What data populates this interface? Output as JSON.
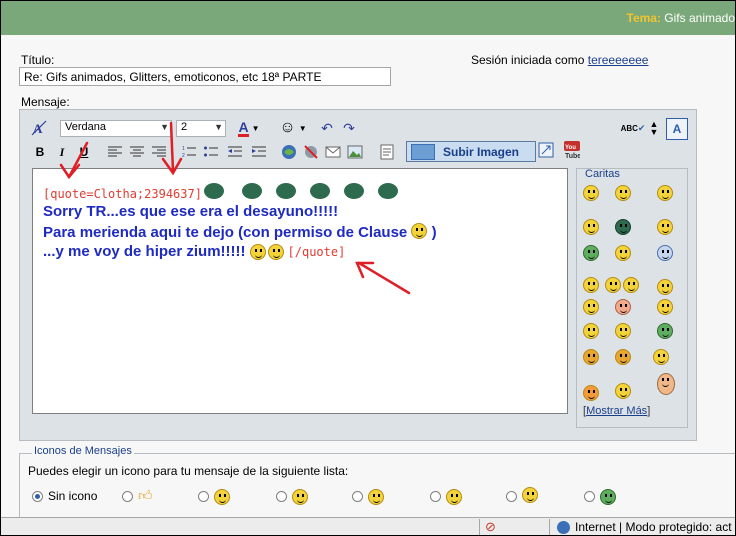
{
  "header": {
    "tema_label": "Tema:",
    "tema_value": "Gifs animado"
  },
  "form": {
    "titulo_label": "Título:",
    "titulo_value": "Re: Gifs animados, Glitters, emoticonos, etc 18ª PARTE",
    "session_text": "Sesión iniciada como",
    "session_user": "tereeeeeee",
    "mensaje_label": "Mensaje:"
  },
  "toolbar": {
    "font_name": "Verdana",
    "font_size": "2",
    "bold": "B",
    "italic": "I",
    "underline": "U",
    "font_color_glyph": "A",
    "upload_label": "Subir Imagen",
    "spell_label": "ABC"
  },
  "message": {
    "quote_open": "[quote=Clotha;2394637]",
    "line1": "Sorry TR...es que ese era el desayuno!!!!!",
    "line2": "Para merienda aqui te dejo (con permiso de Clause",
    "line2_end": ")",
    "line3": "...y me voy de hiper zium!!!!!",
    "quote_close": "[/quote]"
  },
  "smilies": {
    "legend": "Caritas",
    "more_prefix": "[",
    "more_link": "Mostrar Más",
    "more_suffix": "]"
  },
  "message_icons": {
    "legend": "Iconos de Mensajes",
    "instructions": "Puedes elegir un icono para tu mensaje de la siguiente lista:",
    "none_label": "Sin icono"
  },
  "statusbar": {
    "zone_text": "Internet | Modo protegido: act"
  },
  "colors": {
    "header_green": "#7aa87a",
    "quote_red": "#e03c31",
    "message_blue": "#1f2bc0",
    "arrow_red": "#e01e25"
  }
}
